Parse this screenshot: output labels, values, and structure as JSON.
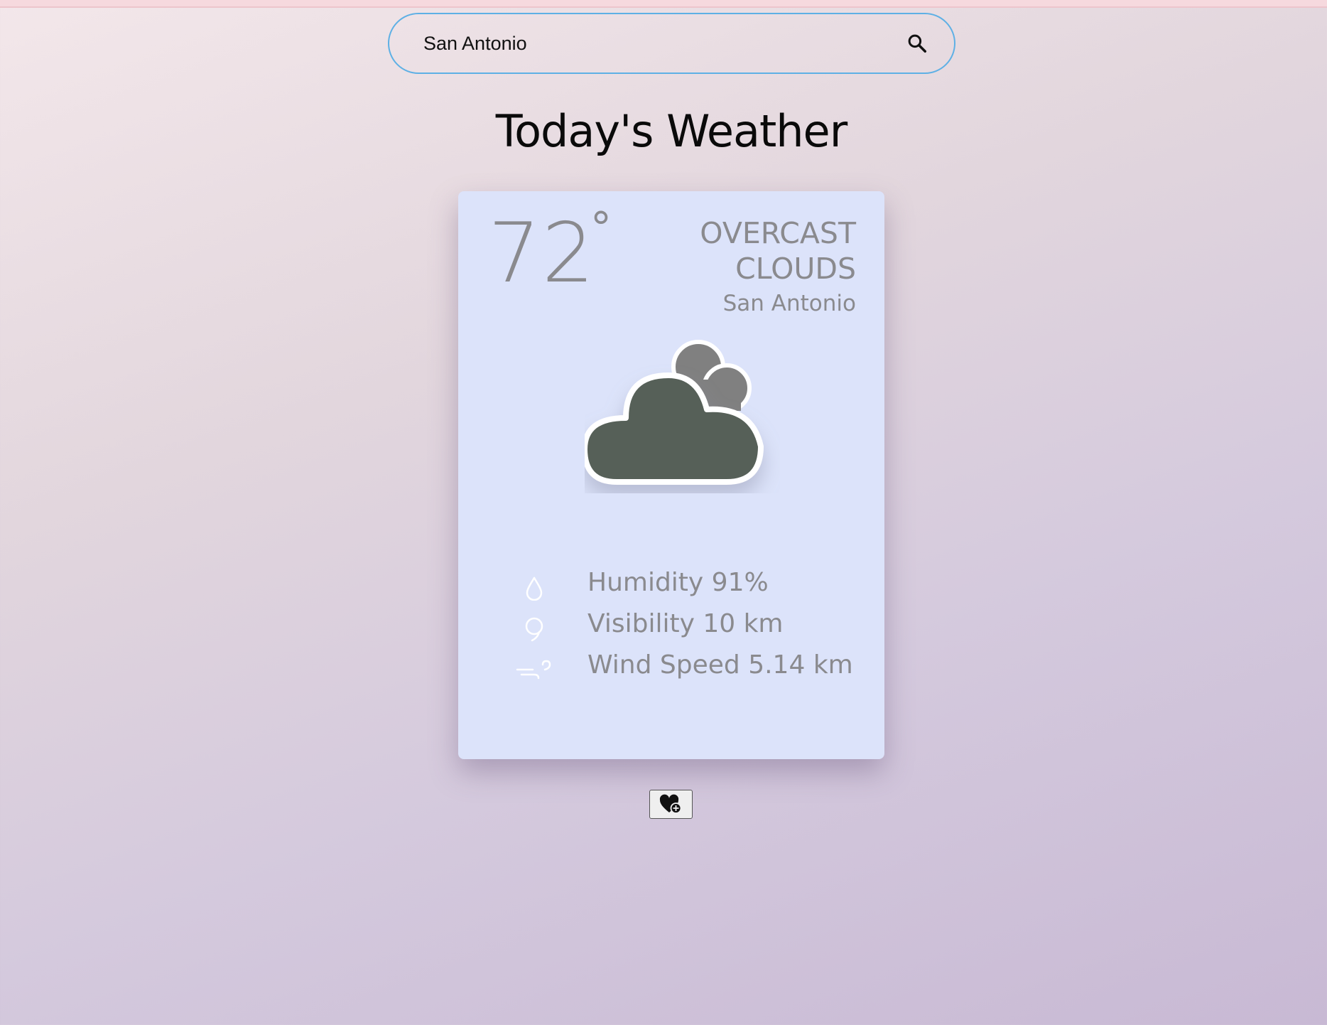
{
  "search": {
    "value": "San Antonio",
    "placeholder": ""
  },
  "header": {
    "title": "Today's Weather"
  },
  "weather": {
    "temperature": "72",
    "degree_symbol": "°",
    "description": "overcast clouds",
    "city": "San Antonio",
    "condition_icon": "overcast-clouds-icon"
  },
  "stats": {
    "humidity": "Humidity 91%",
    "visibility": "Visibility 10 km",
    "wind": "Wind Speed 5.14 km"
  },
  "actions": {
    "favorite_icon": "heart-plus-icon"
  },
  "colors": {
    "card_background": "#dce3fa",
    "muted_text": "#8a8a8e",
    "search_border": "#5eb0e5",
    "cloud_front": "#566058",
    "cloud_back": "#808080"
  }
}
